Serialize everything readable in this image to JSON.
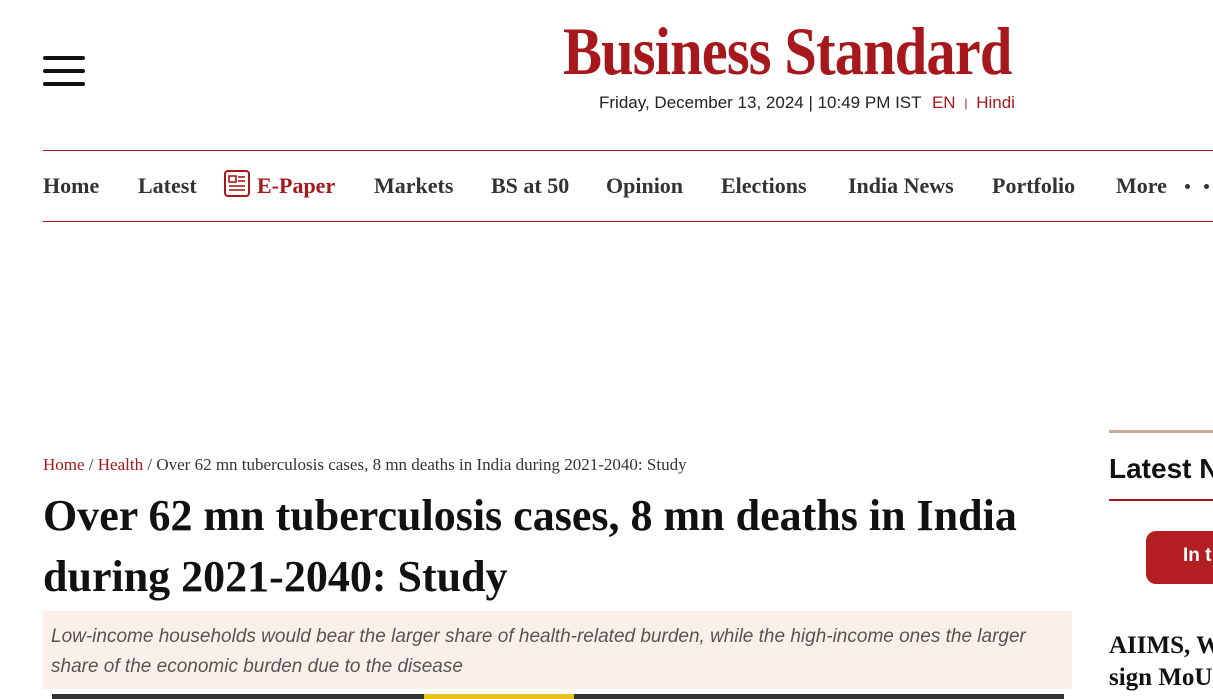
{
  "header": {
    "logo_text": "Business Standard",
    "date": "Friday, December 13, 2024 | 10:49 PM IST",
    "lang_en": "EN",
    "lang_sep": "|",
    "lang_hindi": "Hindi"
  },
  "nav": {
    "items": [
      "Home",
      "Latest",
      "E-Paper",
      "Markets",
      "BS at 50",
      "Opinion",
      "Elections",
      "India News",
      "Portfolio",
      "More"
    ]
  },
  "breadcrumb": {
    "home": "Home",
    "sep1": "/",
    "section": "Health",
    "sep2": "/",
    "current": "Over 62 mn tuberculosis cases, 8 mn deaths in India during 2021-2040: Study"
  },
  "article": {
    "title": "Over 62 mn tuberculosis cases, 8 mn deaths in India during 2021-2040: Study",
    "summary": "Low-income households would bear the larger share of health-related burden, while the high-income ones the larger share of the economic burden due to the disease"
  },
  "sidebar": {
    "title": "Latest N",
    "tab_label": "In t",
    "story_line1": "AIIMS, W",
    "story_line2": "sign MoU"
  },
  "colors": {
    "brand": "#a7181c",
    "summary_bg": "#fbf0e9"
  }
}
